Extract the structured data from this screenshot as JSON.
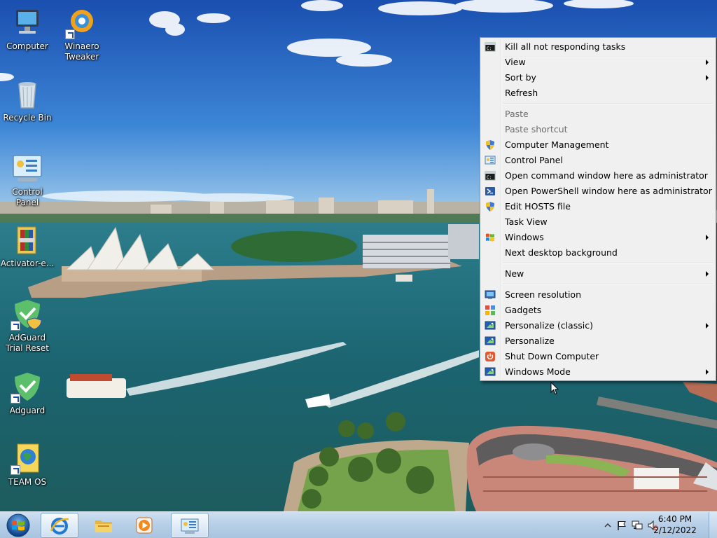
{
  "desktop": {
    "icons": [
      {
        "label": "Computer",
        "icon": "computer-icon"
      },
      {
        "label": "Winaero Tweaker",
        "icon": "winaero-tweaker-icon"
      },
      {
        "label": "Recycle Bin",
        "icon": "recycle-bin-icon"
      },
      {
        "label": "Control Panel",
        "icon": "control-panel-icon"
      },
      {
        "label": "Activator-e...",
        "icon": "archive-icon"
      },
      {
        "label": "AdGuard Trial Reset",
        "icon": "adguard-shield-icon"
      },
      {
        "label": "Adguard",
        "icon": "adguard-shield-icon"
      },
      {
        "label": "TEAM OS",
        "icon": "team-os-globe-icon"
      }
    ]
  },
  "context_menu": {
    "items": [
      {
        "label": "Kill all not responding tasks",
        "icon": "cmd-icon"
      },
      {
        "label": "View",
        "submenu": true
      },
      {
        "label": "Sort by",
        "submenu": true
      },
      {
        "label": "Refresh"
      },
      {
        "label": "Paste",
        "disabled": true
      },
      {
        "label": "Paste shortcut",
        "disabled": true
      },
      {
        "label": "Computer Management",
        "icon": "uac-shield-icon"
      },
      {
        "label": "Control Panel",
        "icon": "control-panel-icon"
      },
      {
        "label": "Open command window here as administrator",
        "icon": "cmd-icon"
      },
      {
        "label": "Open PowerShell window here as administrator",
        "icon": "powershell-icon"
      },
      {
        "label": "Edit HOSTS file",
        "icon": "uac-shield-icon"
      },
      {
        "label": "Task View"
      },
      {
        "label": "Windows",
        "icon": "windows-flag-icon",
        "submenu": true
      },
      {
        "label": "Next desktop background"
      },
      {
        "label": "New",
        "submenu": true
      },
      {
        "label": "Screen resolution",
        "icon": "monitor-icon"
      },
      {
        "label": "Gadgets",
        "icon": "gadgets-icon"
      },
      {
        "label": "Personalize (classic)",
        "icon": "personalize-icon",
        "submenu": true
      },
      {
        "label": "Personalize",
        "icon": "personalize-icon"
      },
      {
        "label": "Shut Down Computer",
        "icon": "power-icon"
      },
      {
        "label": "Windows Mode",
        "icon": "personalize-icon",
        "submenu": true
      }
    ]
  },
  "taskbar": {
    "pinned": [
      {
        "name": "internet-explorer-icon",
        "active": true
      },
      {
        "name": "file-explorer-icon",
        "active": false
      },
      {
        "name": "media-player-icon",
        "active": false
      },
      {
        "name": "control-panel-icon",
        "active": true
      }
    ],
    "clock": {
      "time": "6:40 PM",
      "date": "2/12/2022"
    }
  },
  "colors": {
    "sky_top": "#1d55b3",
    "water": "#1f6f7a",
    "taskbar": "#b8d0e8",
    "menu_bg": "#f0f0f0"
  }
}
